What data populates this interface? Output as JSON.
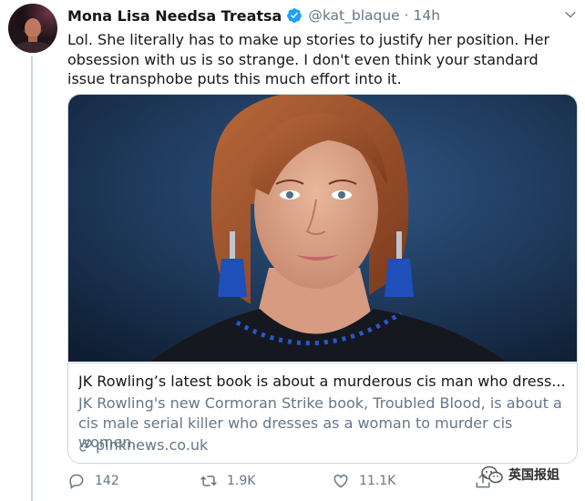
{
  "tweet": {
    "display_name": "Mona Lisa Needsa Treatsa",
    "handle": "@kat_blaque",
    "separator": "·",
    "time": "14h",
    "text": "Lol. She literally has to make up stories to justify her position. Her obsession with us is so strange. I don't even think your standard issue transphobe puts this much effort into it."
  },
  "card": {
    "title": "JK Rowling’s latest book is about a murderous cis man who dress...",
    "description": "JK Rowling's new Cormoran Strike book, Troubled Blood, is about a cis male serial killer who dresses as a woman to murder cis women.",
    "domain": "pinknews.co.uk"
  },
  "actions": {
    "replies": "142",
    "retweets": "1.9K",
    "likes": "11.1K"
  },
  "watermark": {
    "text": "英国报姐"
  },
  "colors": {
    "verified": "#1da1f2",
    "muted": "#657786",
    "border": "#ccd6dd"
  }
}
